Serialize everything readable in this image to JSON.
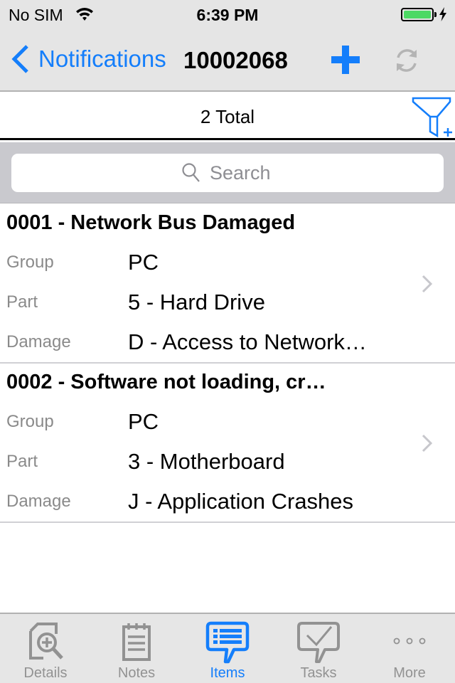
{
  "status_bar": {
    "carrier": "No SIM",
    "time": "6:39 PM",
    "battery_level": 1.0,
    "charging": true
  },
  "nav": {
    "back_label": "Notifications",
    "title": "10002068",
    "add_icon": "plus-icon",
    "refresh_icon": "refresh-icon"
  },
  "summary": {
    "total_text": "2 Total",
    "filter_icon": "filter-add-icon"
  },
  "search": {
    "placeholder": "Search",
    "value": ""
  },
  "items": [
    {
      "title": "0001 - Network Bus Damaged",
      "fields": [
        {
          "label": "Group",
          "value": "PC"
        },
        {
          "label": "Part",
          "value": "5 - Hard Drive"
        },
        {
          "label": "Damage",
          "value": "D - Access to Network…"
        }
      ]
    },
    {
      "title": "0002 - Software not loading, cr…",
      "fields": [
        {
          "label": "Group",
          "value": "PC"
        },
        {
          "label": "Part",
          "value": "3 - Motherboard"
        },
        {
          "label": "Damage",
          "value": "J - Application Crashes"
        }
      ]
    }
  ],
  "tabbar": {
    "active": "Items",
    "tabs": [
      {
        "label": "Details",
        "icon": "document-zoom-icon"
      },
      {
        "label": "Notes",
        "icon": "notepad-icon"
      },
      {
        "label": "Items",
        "icon": "list-bubble-icon"
      },
      {
        "label": "Tasks",
        "icon": "check-bubble-icon"
      },
      {
        "label": "More",
        "icon": "more-dots-icon"
      }
    ]
  },
  "colors": {
    "accent": "#147efb",
    "inactive": "#929292",
    "battery": "#4cd964",
    "bar_bg": "#e5e5e5",
    "search_bg": "#c9c9ce"
  }
}
